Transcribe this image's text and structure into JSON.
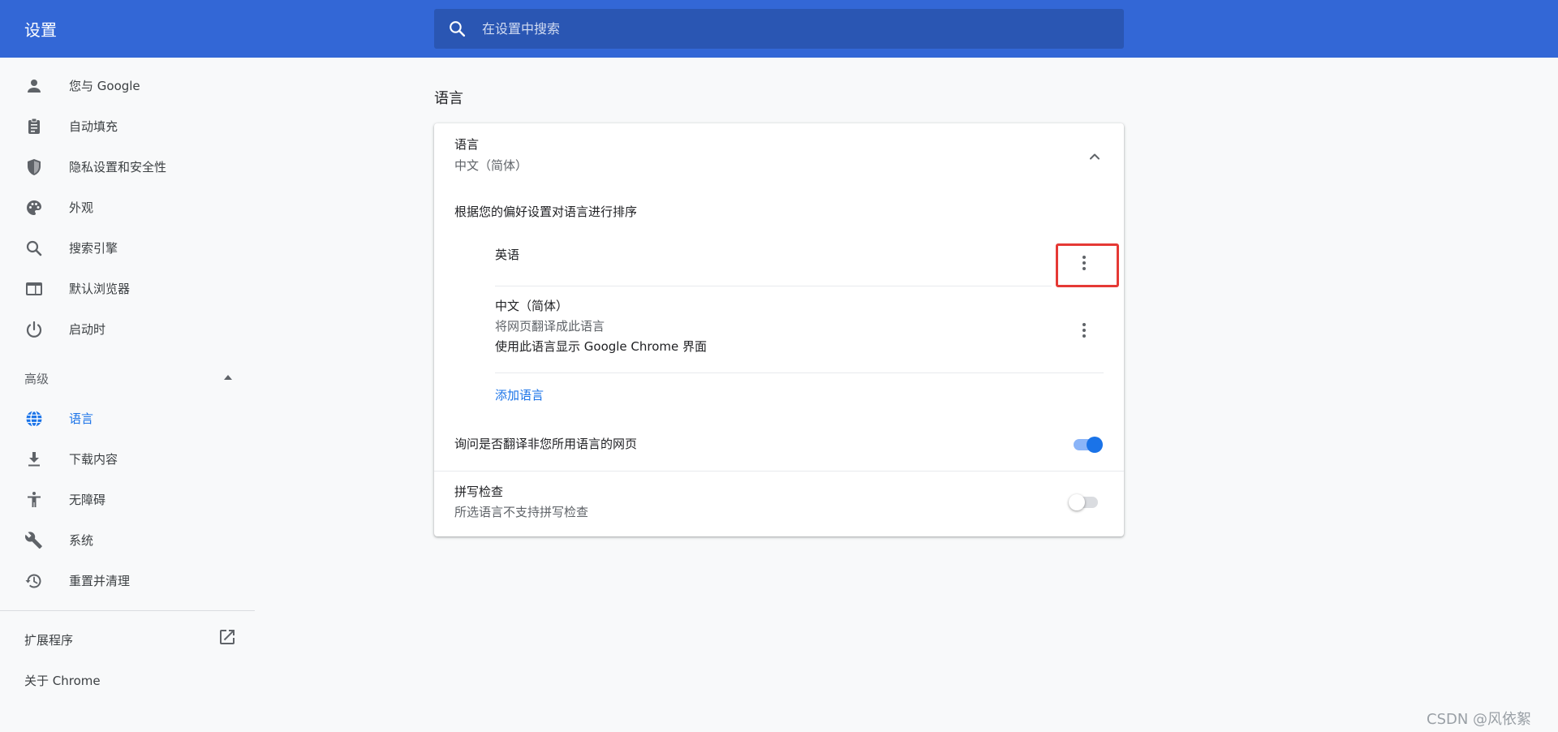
{
  "header": {
    "title": "设置",
    "search_placeholder": "在设置中搜索"
  },
  "sidebar": {
    "items": [
      {
        "label": "您与 Google",
        "icon": "person-icon"
      },
      {
        "label": "自动填充",
        "icon": "clipboard-icon"
      },
      {
        "label": "隐私设置和安全性",
        "icon": "shield-icon"
      },
      {
        "label": "外观",
        "icon": "palette-icon"
      },
      {
        "label": "搜索引擎",
        "icon": "search-icon"
      },
      {
        "label": "默认浏览器",
        "icon": "browser-window-icon"
      },
      {
        "label": "启动时",
        "icon": "power-icon"
      }
    ],
    "advanced": {
      "label": "高级",
      "items": [
        {
          "label": "语言",
          "icon": "globe-icon",
          "active": true
        },
        {
          "label": "下载内容",
          "icon": "download-icon"
        },
        {
          "label": "无障碍",
          "icon": "accessibility-icon"
        },
        {
          "label": "系统",
          "icon": "wrench-icon"
        },
        {
          "label": "重置并清理",
          "icon": "history-icon"
        }
      ]
    },
    "extensions_label": "扩展程序",
    "about_label": "关于 Chrome"
  },
  "main": {
    "section_title": "语言",
    "card": {
      "language_title": "语言",
      "language_value": "中文（简体）",
      "order_hint": "根据您的偏好设置对语言进行排序",
      "languages": [
        {
          "name": "英语",
          "lines": []
        },
        {
          "name": "中文（简体）",
          "lines": [
            "将网页翻译成此语言",
            "使用此语言显示 Google Chrome 界面"
          ]
        }
      ],
      "add_language": "添加语言",
      "translate_label": "询问是否翻译非您所用语言的网页",
      "translate_enabled": true,
      "spellcheck_title": "拼写检查",
      "spellcheck_subtitle": "所选语言不支持拼写检查",
      "spellcheck_enabled": false
    }
  },
  "colors": {
    "header": "#3367d6",
    "accent": "#1a73e8",
    "highlight": "#e53935"
  },
  "watermark": "CSDN @风依絮"
}
